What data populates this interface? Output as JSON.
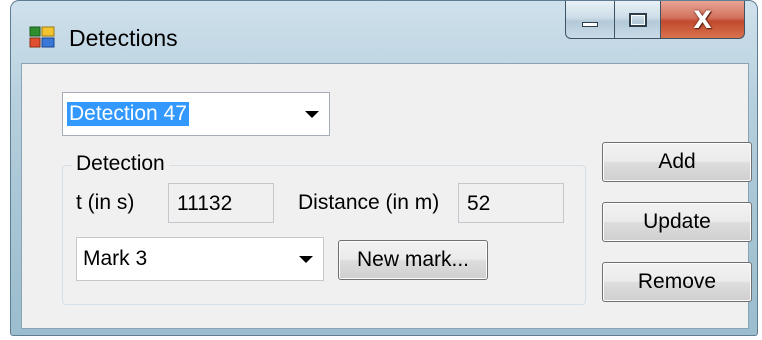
{
  "window": {
    "title": "Detections"
  },
  "detection_select": {
    "selected": "Detection 47"
  },
  "group": {
    "label": "Detection",
    "time_label": "t (in s)",
    "time_value": "11132",
    "distance_label": "Distance (in m)",
    "distance_value": "52",
    "mark_select": "Mark 3",
    "new_mark_label": "New mark..."
  },
  "actions": {
    "add": "Add",
    "update": "Update",
    "remove": "Remove"
  },
  "icons": {
    "app": "app-window-icon",
    "minimize": "minimize-icon",
    "maximize": "maximize-icon",
    "close": "close-icon",
    "dropdown": "chevron-down-icon"
  },
  "colors": {
    "selection_highlight": "#3399ff",
    "close_button": "#c04a2e",
    "client_background": "#f0f0f0"
  }
}
